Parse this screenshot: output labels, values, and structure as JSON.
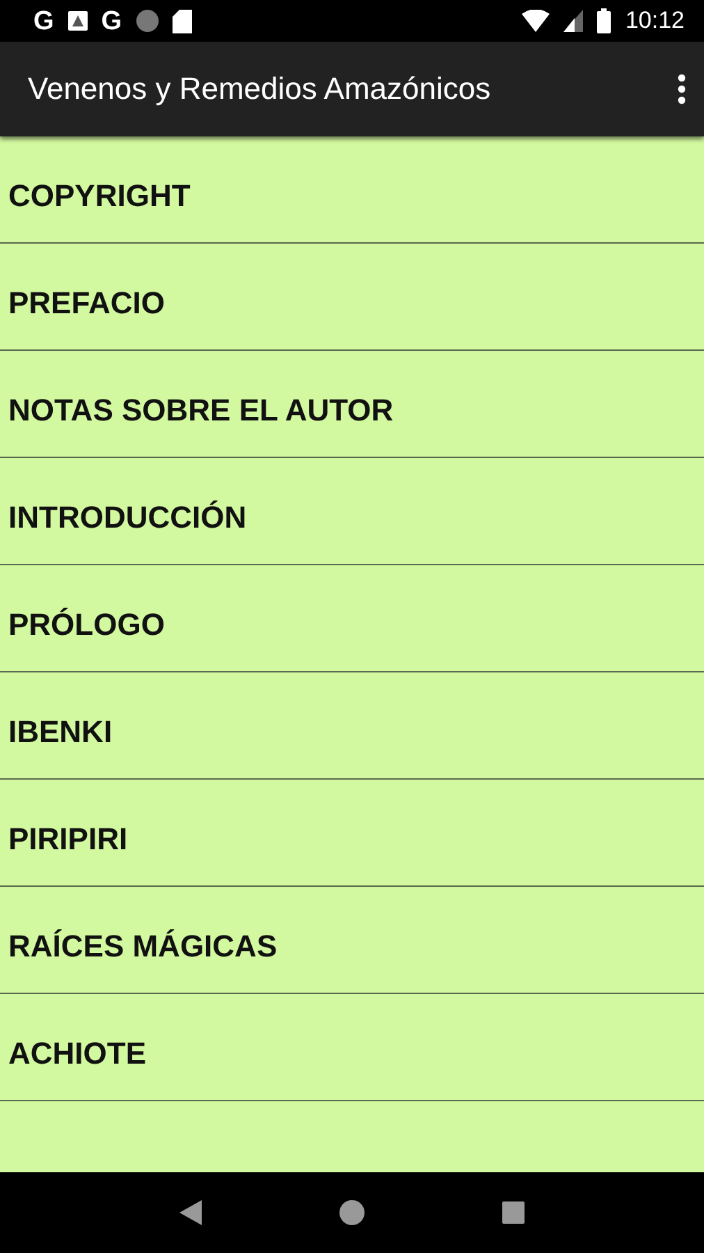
{
  "status_bar": {
    "notifications": [
      {
        "kind": "glyph",
        "text": "G"
      },
      {
        "kind": "image"
      },
      {
        "kind": "glyph",
        "text": "G"
      },
      {
        "kind": "dot"
      },
      {
        "kind": "card"
      }
    ],
    "time": "10:12"
  },
  "app_bar": {
    "title": "Venenos y Remedios Amazónicos"
  },
  "chapters": [
    "COPYRIGHT",
    "PREFACIO",
    "NOTAS SOBRE EL AUTOR",
    "INTRODUCCIÓN",
    "PRÓLOGO",
    "IBENKI",
    "PIRIPIRI",
    "RAÍCES MÁGICAS",
    "ACHIOTE"
  ]
}
